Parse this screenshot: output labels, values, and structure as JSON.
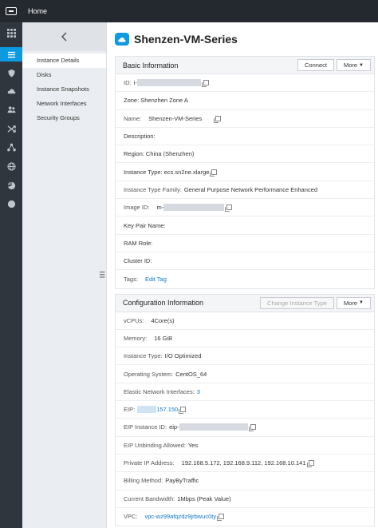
{
  "topbar": {
    "home_label": "Home"
  },
  "rail": {
    "items": [
      {
        "icon": "grid-icon"
      },
      {
        "icon": "list-icon",
        "active": true
      },
      {
        "icon": "shield-icon"
      },
      {
        "icon": "cloud-icon"
      },
      {
        "icon": "people-icon"
      },
      {
        "icon": "shuffle-icon"
      },
      {
        "icon": "network-icon"
      },
      {
        "icon": "globe-icon"
      },
      {
        "icon": "chart-icon"
      },
      {
        "icon": "circle-icon"
      }
    ]
  },
  "sidebar": {
    "items": [
      {
        "label": "Instance Details",
        "active": true
      },
      {
        "label": "Disks"
      },
      {
        "label": "Instance Snapshots"
      },
      {
        "label": "Network Interfaces"
      },
      {
        "label": "Security Groups"
      }
    ]
  },
  "page": {
    "title": "Shenzen-VM-Series"
  },
  "basic": {
    "title": "Basic Information",
    "connect_label": "Connect",
    "more_label": "More",
    "id_label": "ID:",
    "id_prefix": "i-",
    "zone": "Zone: Shenzhen Zone A",
    "name_label": "Name:",
    "name_value": "Shenzen-VM-Series",
    "description": "Description:",
    "region": "Region: China (Shenzhen)",
    "instance_type": "Instance Type: ecs.sn2ne.xlarge",
    "type_family_label": "Instance Type Family:",
    "type_family_value": "General Purpose Network Performance Enhanced",
    "image_label": "Image ID:",
    "image_prefix": "m-",
    "key_pair": "Key Pair Name:",
    "ram_role": "RAM Role:",
    "cluster": "Cluster ID:",
    "tags_label": "Tags:",
    "edit_tag": "Edit Tag"
  },
  "config": {
    "title": "Configuration Information",
    "change_label": "Change Instance Type",
    "more_label": "More",
    "vcpus_label": "vCPUs:",
    "vcpus_value": "4Core(s)",
    "memory_label": "Memory:",
    "memory_value": "16 GiB",
    "instance_type_label": "Instance Type:",
    "instance_type_value": "I/O Optimized",
    "os_label": "Operating System:",
    "os_value": "CentOS_64",
    "eni_label": "Elastic Network Interfaces:",
    "eni_value": "3",
    "eip_label": "EIP:",
    "eip_value": "157.150",
    "eip_id_label": "EIP Instance ID:",
    "eip_id_prefix": "eip-",
    "unbinding_label": "EIP Unbinding Allowed:",
    "unbinding_value": "Yes",
    "private_ip_label": "Private IP Address:",
    "private_ip_value": "192.168.5.172, 192.168.9.112, 192.168.10.141",
    "billing_label": "Billing Method:",
    "billing_value": "PayByTraffic",
    "bandwidth_label": "Current Bandwidth:",
    "bandwidth_value": "1Mbps (Peak Value)",
    "vpc_label": "VPC:",
    "vpc_value": "vpc-wz99afqzdz9jrbwuc0ty"
  },
  "colors": {
    "accent": "#0d9ae0",
    "topbar": "#24292f",
    "rail": "#30363d",
    "link": "#0d78c8"
  }
}
